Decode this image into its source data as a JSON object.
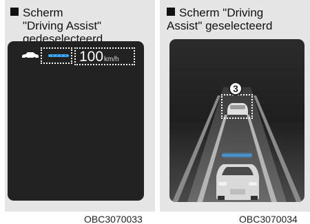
{
  "left_panel": {
    "caption_lines": [
      "Scherm",
      "\"Driving Assist\"",
      "gedeselecteerd"
    ],
    "speed_value": "100",
    "speed_unit": "km/h",
    "figure_code": "OBC3070033"
  },
  "right_panel": {
    "caption_lines": [
      "Scherm \"Driving",
      "Assist\" geselecteerd"
    ],
    "callout_number": "3",
    "figure_code": "OBC3070034"
  },
  "colors": {
    "panel_background": "#e5e5e5",
    "screen_dark": "#222222",
    "lane_highlight": "#3fa9f5",
    "dotted_callout": "#ffffff"
  },
  "icons": [
    "square-bullet-icon",
    "car-icon",
    "lane-line-icon",
    "front-car-icon",
    "own-car-icon"
  ]
}
